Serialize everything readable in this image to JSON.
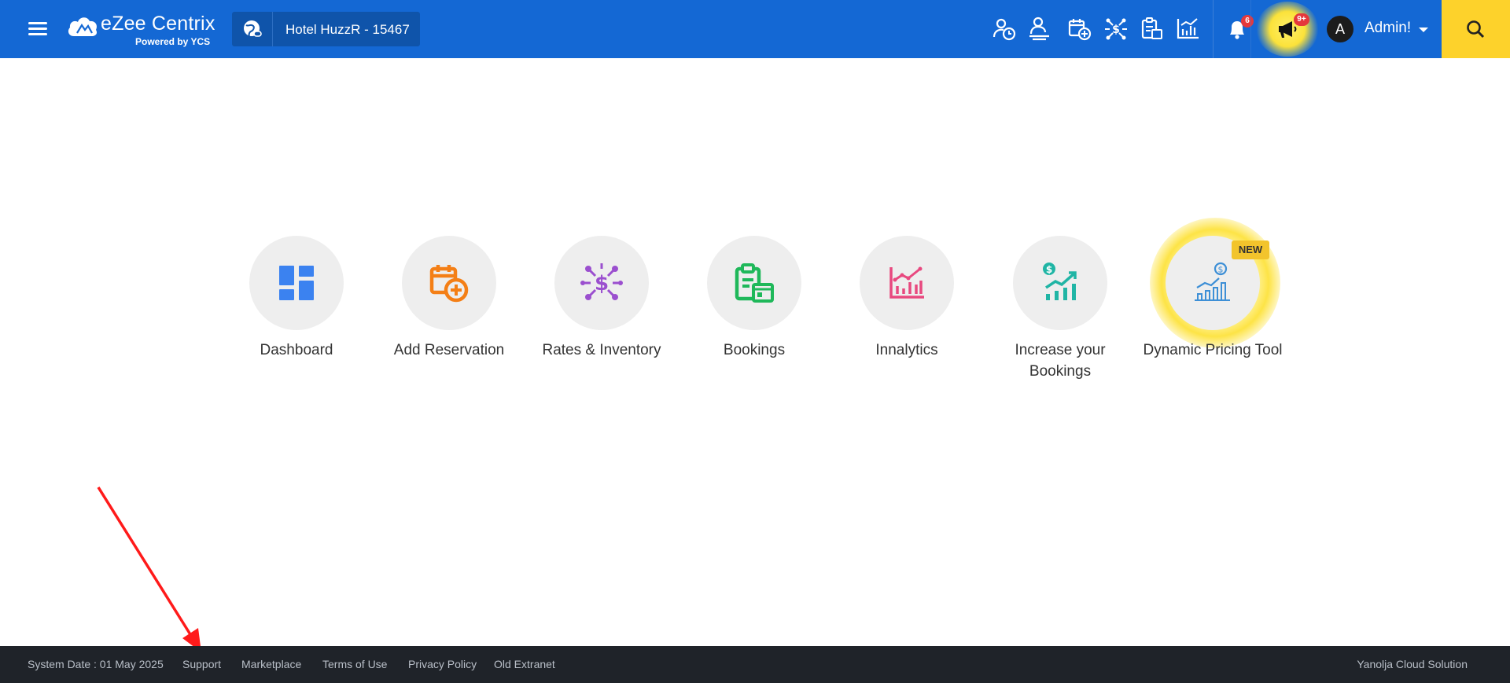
{
  "header": {
    "brand_title": "eZee Centrix",
    "brand_subtitle": "Powered by YCS",
    "hotel_name": "Hotel HuzzR -  15467",
    "notification_count": "6",
    "promo_count": "9+",
    "avatar_initial": "A",
    "user_name": "Admin!",
    "icons": [
      "menu-icon",
      "globe-link-icon",
      "user-clock-icon",
      "guest-icon",
      "calendar-add-icon",
      "rates-network-icon",
      "bookings-clipboard-icon",
      "analytics-chart-icon",
      "bell-icon",
      "megaphone-icon",
      "search-icon"
    ]
  },
  "tiles": [
    {
      "label": "Dashboard",
      "icon": "dashboard-icon",
      "color": "#3b82f0"
    },
    {
      "label": "Add Reservation",
      "icon": "calendar-add-icon",
      "color": "#f47f16"
    },
    {
      "label": "Rates & Inventory",
      "icon": "rates-network-icon",
      "color": "#9b4fcf"
    },
    {
      "label": "Bookings",
      "icon": "bookings-clipboard-icon",
      "color": "#1fb85a"
    },
    {
      "label": "Innalytics",
      "icon": "analytics-chart-icon",
      "color": "#e8487f"
    },
    {
      "label": "Increase your Bookings",
      "icon": "growth-chart-icon",
      "color": "#20b5a5"
    },
    {
      "label": "Dynamic Pricing Tool",
      "icon": "pricing-chart-icon",
      "color": "#3d8fd6",
      "badge": "NEW"
    }
  ],
  "footer": {
    "system_date": "System Date : 01 May 2025",
    "links": [
      "Support",
      "Marketplace",
      "Terms of Use",
      "Privacy Policy",
      "Old Extranet"
    ],
    "company": "Yanolja Cloud Solution"
  },
  "colors": {
    "topbar": "#1468d4",
    "search_button": "#fdd22b",
    "footer": "#1f2329",
    "highlight_glow": "#fde23c",
    "annotation_arrow": "#ff1a1a"
  }
}
